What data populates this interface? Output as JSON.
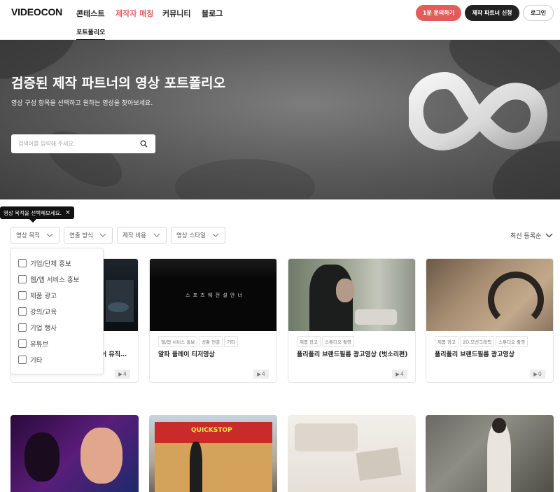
{
  "header": {
    "logo": "VIDEOCON",
    "nav": [
      "콘테스트",
      "제작자 매칭",
      "커뮤니티",
      "블로그"
    ],
    "subnav": "포트폴리오",
    "buttons": {
      "inquiry": "1분 문의하기",
      "partner": "제작 파트너 신청",
      "login": "로그인"
    },
    "colors": {
      "accent": "#e35b5b",
      "dark": "#222222"
    }
  },
  "hero": {
    "title": "검증된 제작 파트너의 영상 포트폴리오",
    "subtitle": "영상 구성 항목을 선택하고 원하는 영상을 찾아보세요.",
    "search_placeholder": "검색어를 입력해 주세요."
  },
  "tooltip": {
    "text": "영상 목적을 선택해보세요.",
    "close": "×"
  },
  "filters": [
    "영상 목적",
    "연출 방식",
    "제작 비용",
    "영상 스타일"
  ],
  "sort": "최신 등록순",
  "purpose_options": [
    "기업/단체 홍보",
    "웹/앱 서비스 홍보",
    "제품 광고",
    "강의/교육",
    "기업 행사",
    "유튜브",
    "기타"
  ],
  "cards": [
    {
      "title": "어 뮤직…",
      "tags": [],
      "views": "4"
    },
    {
      "title": "알파 플레이 티저영상",
      "tags": [
        "웹/앱 서비스 홍보",
        "상황 연출",
        "기타"
      ],
      "views": "4",
      "overlay": "스 포 츠 웨   전 설 안   너"
    },
    {
      "title": "폴리폴리 브랜드필름 광고영상 (벗소리편)",
      "tags": [
        "제품 광고",
        "스튜디오 촬영"
      ],
      "views": "4"
    },
    {
      "title": "폴리폴리 브랜드필름 광고영상",
      "tags": [
        "제품 광고",
        "2D,모션그래픽",
        "스튜디오 촬영"
      ],
      "views": "0"
    }
  ],
  "second_row": {
    "sign_text": "QUICKSTOP"
  }
}
